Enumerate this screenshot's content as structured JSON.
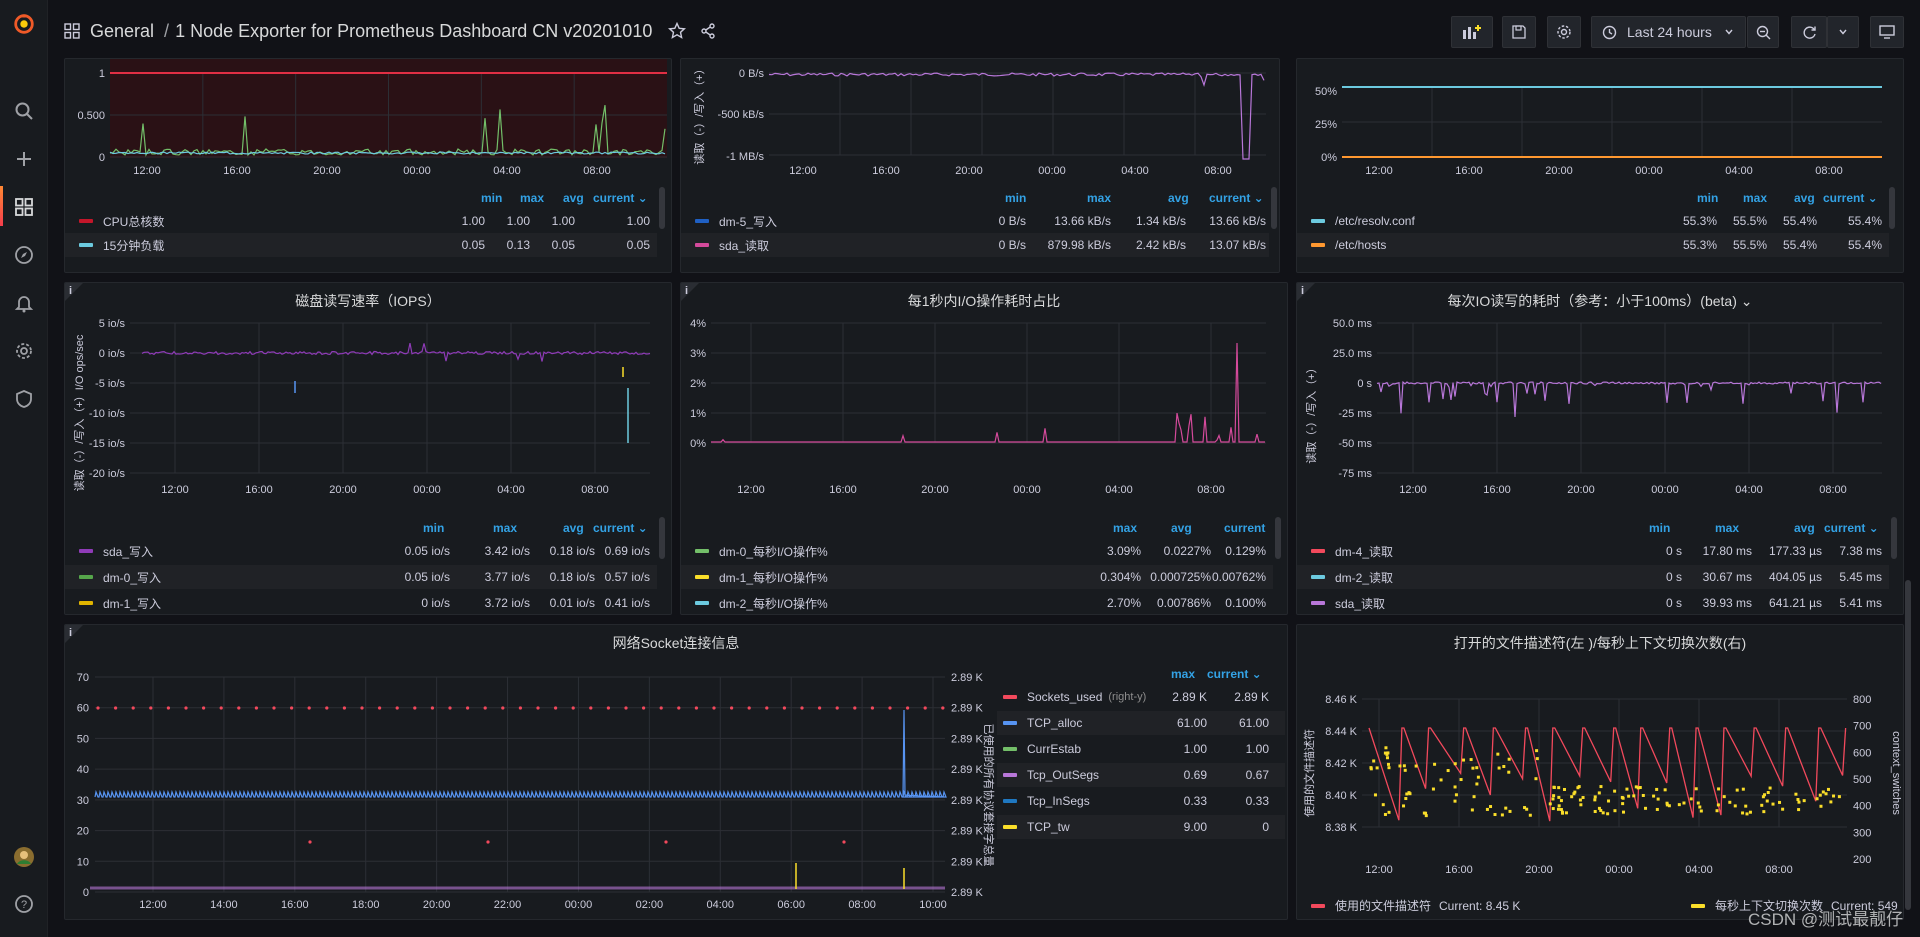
{
  "breadcrumb": {
    "folder": "General",
    "sep": "/",
    "dashboard": "1 Node Exporter for Prometheus Dashboard CN v20201010"
  },
  "time_picker": {
    "label": "Last 24 hours"
  },
  "watermark": "CSDN @测试最靓仔",
  "colors": {
    "red": "#f2495c",
    "blue": "#5794f2",
    "green": "#73bf69",
    "yellow": "#fade2a",
    "purple": "#b877d9",
    "cyan": "#6ccadf",
    "orange": "#ff9830",
    "darkred": "#c4162a",
    "magenta": "#d44a9b"
  },
  "xticks_day": [
    "12:00",
    "16:00",
    "20:00",
    "00:00",
    "04:00",
    "08:00"
  ],
  "panel_load": {
    "yticks": [
      "1",
      "0.500",
      "0"
    ],
    "legend_hdr": {
      "min": "min",
      "max": "max",
      "avg": "avg",
      "current": "current ⌄"
    },
    "rows": [
      {
        "name": "CPU总核数",
        "color": "#c4162a",
        "min": "1.00",
        "max": "1.00",
        "avg": "1.00",
        "cur": "1.00"
      },
      {
        "name": "15分钟负载",
        "color": "#6ccadf",
        "min": "0.05",
        "max": "0.13",
        "avg": "0.05",
        "cur": "0.05"
      }
    ]
  },
  "panel_net": {
    "ylabel": "读取（-）/写入（+）",
    "yticks": [
      "0 B/s",
      "-500 kB/s",
      "-1 MB/s"
    ],
    "legend_hdr": {
      "min": "min",
      "max": "max",
      "avg": "avg",
      "current": "current ⌄"
    },
    "rows": [
      {
        "name": "dm-5_写入",
        "color": "#1f60c4",
        "min": "0 B/s",
        "max": "13.66 kB/s",
        "avg": "1.34 kB/s",
        "cur": "13.66 kB/s"
      },
      {
        "name": "sda_读取",
        "color": "#b877d9",
        "min": "0 B/s",
        "max": "879.98 kB/s",
        "avg": "2.42 kB/s",
        "cur": "13.07 kB/s"
      }
    ]
  },
  "panel_fs": {
    "yticks": [
      "50%",
      "25%",
      "0%"
    ],
    "legend_hdr": {
      "min": "min",
      "max": "max",
      "avg": "avg",
      "current": "current ⌄"
    },
    "rows": [
      {
        "name": "/etc/resolv.conf",
        "color": "#6ccadf",
        "min": "55.3%",
        "max": "55.5%",
        "avg": "55.4%",
        "cur": "55.4%"
      },
      {
        "name": "/etc/hosts",
        "color": "#ff9830",
        "min": "55.3%",
        "max": "55.5%",
        "avg": "55.4%",
        "cur": "55.4%"
      }
    ]
  },
  "panel_iops": {
    "title": "磁盘读写速率（IOPS）",
    "ylabel": "读取（-）/写入（+）I/O ops/sec",
    "yticks": [
      "5 io/s",
      "0 io/s",
      "-5 io/s",
      "-10 io/s",
      "-15 io/s",
      "-20 io/s"
    ],
    "legend_hdr": {
      "min": "min",
      "max": "max",
      "avg": "avg",
      "current": "current ⌄"
    },
    "rows": [
      {
        "name": "sda_写入",
        "color": "#8f3bb8",
        "min": "0.05 io/s",
        "max": "3.42 io/s",
        "avg": "0.18 io/s",
        "cur": "0.69 io/s"
      },
      {
        "name": "dm-0_写入",
        "color": "#56a64b",
        "min": "0.05 io/s",
        "max": "3.77 io/s",
        "avg": "0.18 io/s",
        "cur": "0.57 io/s"
      },
      {
        "name": "dm-1_写入",
        "color": "#e0b400",
        "min": "0 io/s",
        "max": "3.72 io/s",
        "avg": "0.01 io/s",
        "cur": "0.41 io/s"
      }
    ]
  },
  "panel_io": {
    "title": "每1秒内I/O操作耗时占比",
    "yticks": [
      "4%",
      "3%",
      "2%",
      "1%",
      "0%"
    ],
    "legend_hdr": {
      "max": "max",
      "avg": "avg",
      "current": "current"
    },
    "rows": [
      {
        "name": "dm-0_每秒I/O操作%",
        "color": "#73bf69",
        "max": "3.09%",
        "avg": "0.0227%",
        "cur": "0.129%"
      },
      {
        "name": "dm-1_每秒I/O操作%",
        "color": "#fade2a",
        "max": "0.304%",
        "avg": "0.000725%",
        "cur": "0.00762%"
      },
      {
        "name": "dm-2_每秒I/O操作%",
        "color": "#6ccadf",
        "max": "2.70%",
        "avg": "0.00786%",
        "cur": "0.100%"
      }
    ]
  },
  "panel_lat": {
    "title": "每次IO读写的耗时（参考：小于100ms）(beta)",
    "ylabel": "读取（-）/写入（+）",
    "yticks": [
      "50.0 ms",
      "25.0 ms",
      "0 s",
      "-25 ms",
      "-50 ms",
      "-75 ms"
    ],
    "legend_hdr": {
      "min": "min",
      "max": "max",
      "avg": "avg",
      "current": "current ⌄"
    },
    "rows": [
      {
        "name": "dm-4_读取",
        "color": "#f2495c",
        "min": "0 s",
        "max": "17.80 ms",
        "avg": "177.33 µs",
        "cur": "7.38 ms"
      },
      {
        "name": "dm-2_读取",
        "color": "#6ccadf",
        "min": "0 s",
        "max": "30.67 ms",
        "avg": "404.05 µs",
        "cur": "5.45 ms"
      },
      {
        "name": "sda_读取",
        "color": "#b877d9",
        "min": "0 s",
        "max": "39.93 ms",
        "avg": "641.21 µs",
        "cur": "5.41 ms"
      }
    ]
  },
  "panel_sock": {
    "title": "网络Socket连接信息",
    "yticks_left": [
      "70",
      "60",
      "50",
      "40",
      "30",
      "20",
      "10",
      "0"
    ],
    "yticks_right": [
      "2.89 K",
      "2.89 K",
      "2.89 K",
      "2.89 K",
      "2.89 K",
      "2.89 K",
      "2.89 K",
      "2.89 K"
    ],
    "ylabel_right": "已使用的所有协议套接字总量",
    "xticks": [
      "12:00",
      "14:00",
      "16:00",
      "18:00",
      "20:00",
      "22:00",
      "00:00",
      "02:00",
      "04:00",
      "06:00",
      "08:00",
      "10:00"
    ],
    "legend_hdr": {
      "max": "max",
      "current": "current ⌄"
    },
    "rows": [
      {
        "name": "Sockets_used",
        "tag": "(right-y)",
        "color": "#f2495c",
        "max": "2.89 K",
        "cur": "2.89 K"
      },
      {
        "name": "TCP_alloc",
        "tag": "",
        "color": "#5794f2",
        "max": "61.00",
        "cur": "61.00"
      },
      {
        "name": "CurrEstab",
        "tag": "",
        "color": "#73bf69",
        "max": "1.00",
        "cur": "1.00"
      },
      {
        "name": "Tcp_OutSegs",
        "tag": "",
        "color": "#b877d9",
        "max": "0.69",
        "cur": "0.67"
      },
      {
        "name": "Tcp_InSegs",
        "tag": "",
        "color": "#1f78c1",
        "max": "0.33",
        "cur": "0.33"
      },
      {
        "name": "TCP_tw",
        "tag": "",
        "color": "#fade2a",
        "max": "9.00",
        "cur": "0"
      }
    ]
  },
  "panel_fd": {
    "title": "打开的文件描述符(左 )/每秒上下文切换次数(右)",
    "ylabel_left": "使用的文件描述符",
    "ylabel_right": "context_switches",
    "yticks_left": [
      "8.46 K",
      "8.44 K",
      "8.42 K",
      "8.40 K",
      "8.38 K"
    ],
    "yticks_right": [
      "800",
      "700",
      "600",
      "500",
      "400",
      "300",
      "200"
    ],
    "legend": [
      {
        "name": "使用的文件描述符",
        "color": "#f2495c",
        "cur": "Current: 8.45 K"
      },
      {
        "name": "每秒上下文切换次数",
        "color": "#fade2a",
        "cur": "Current: 549"
      }
    ]
  }
}
